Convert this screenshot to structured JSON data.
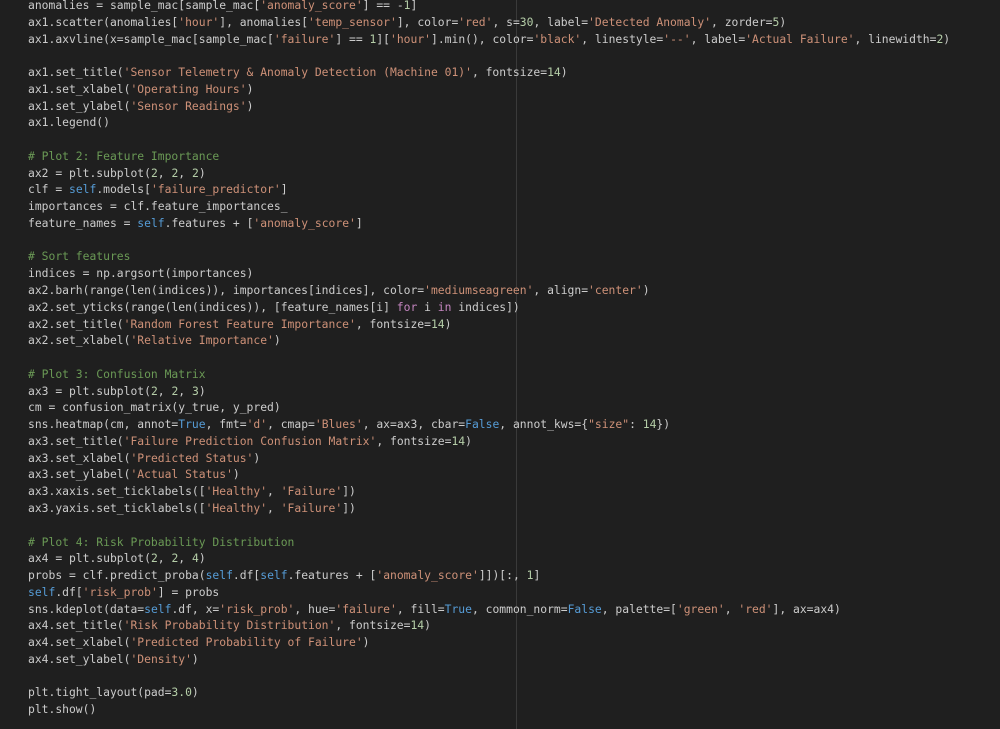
{
  "editor": {
    "colors": {
      "background": "#1f1f1f",
      "text": "#cccccc",
      "string": "#ce9178",
      "number": "#b5cea8",
      "keyword": "#569cd6",
      "control": "#c586c0",
      "comment": "#6a9955",
      "ruler": "#3a3a3a"
    },
    "lines": [
      [
        [
          "plain",
          "anomalies = sample_mac[sample_mac["
        ],
        [
          "str",
          "'anomaly_score'"
        ],
        [
          "plain",
          "] == -"
        ],
        [
          "num",
          "1"
        ],
        [
          "plain",
          "]"
        ]
      ],
      [
        [
          "plain",
          "ax1.scatter(anomalies["
        ],
        [
          "str",
          "'hour'"
        ],
        [
          "plain",
          "], anomalies["
        ],
        [
          "str",
          "'temp_sensor'"
        ],
        [
          "plain",
          "], color="
        ],
        [
          "str",
          "'red'"
        ],
        [
          "plain",
          ", s="
        ],
        [
          "num",
          "30"
        ],
        [
          "plain",
          ", label="
        ],
        [
          "str",
          "'Detected Anomaly'"
        ],
        [
          "plain",
          ", zorder="
        ],
        [
          "num",
          "5"
        ],
        [
          "plain",
          ")"
        ]
      ],
      [
        [
          "plain",
          "ax1.axvline(x=sample_mac[sample_mac["
        ],
        [
          "str",
          "'failure'"
        ],
        [
          "plain",
          "] == "
        ],
        [
          "num",
          "1"
        ],
        [
          "plain",
          "]["
        ],
        [
          "str",
          "'hour'"
        ],
        [
          "plain",
          "].min(), color="
        ],
        [
          "str",
          "'black'"
        ],
        [
          "plain",
          ", linestyle="
        ],
        [
          "str",
          "'--'"
        ],
        [
          "plain",
          ", label="
        ],
        [
          "str",
          "'Actual Failure'"
        ],
        [
          "plain",
          ", linewidth="
        ],
        [
          "num",
          "2"
        ],
        [
          "plain",
          ")"
        ]
      ],
      [],
      [
        [
          "plain",
          "ax1.set_title("
        ],
        [
          "str",
          "'Sensor Telemetry & Anomaly Detection (Machine 01)'"
        ],
        [
          "plain",
          ", fontsize="
        ],
        [
          "num",
          "14"
        ],
        [
          "plain",
          ")"
        ]
      ],
      [
        [
          "plain",
          "ax1.set_xlabel("
        ],
        [
          "str",
          "'Operating Hours'"
        ],
        [
          "plain",
          ")"
        ]
      ],
      [
        [
          "plain",
          "ax1.set_ylabel("
        ],
        [
          "str",
          "'Sensor Readings'"
        ],
        [
          "plain",
          ")"
        ]
      ],
      [
        [
          "plain",
          "ax1.legend()"
        ]
      ],
      [],
      [
        [
          "cmt",
          "# Plot 2: Feature Importance"
        ]
      ],
      [
        [
          "plain",
          "ax2 = plt.subplot("
        ],
        [
          "num",
          "2"
        ],
        [
          "plain",
          ", "
        ],
        [
          "num",
          "2"
        ],
        [
          "plain",
          ", "
        ],
        [
          "num",
          "2"
        ],
        [
          "plain",
          ")"
        ]
      ],
      [
        [
          "plain",
          "clf = "
        ],
        [
          "kw",
          "self"
        ],
        [
          "plain",
          ".models["
        ],
        [
          "str",
          "'failure_predictor'"
        ],
        [
          "plain",
          "]"
        ]
      ],
      [
        [
          "plain",
          "importances = clf.feature_importances_"
        ]
      ],
      [
        [
          "plain",
          "feature_names = "
        ],
        [
          "kw",
          "self"
        ],
        [
          "plain",
          ".features + ["
        ],
        [
          "str",
          "'anomaly_score'"
        ],
        [
          "plain",
          "]"
        ]
      ],
      [],
      [
        [
          "cmt",
          "# Sort features"
        ]
      ],
      [
        [
          "plain",
          "indices = np.argsort(importances)"
        ]
      ],
      [
        [
          "plain",
          "ax2.barh(range(len(indices)), importances[indices], color="
        ],
        [
          "str",
          "'mediumseagreen'"
        ],
        [
          "plain",
          ", align="
        ],
        [
          "str",
          "'center'"
        ],
        [
          "plain",
          ")"
        ]
      ],
      [
        [
          "plain",
          "ax2.set_yticks(range(len(indices)), [feature_names[i] "
        ],
        [
          "ctl",
          "for"
        ],
        [
          "plain",
          " i "
        ],
        [
          "ctl",
          "in"
        ],
        [
          "plain",
          " indices])"
        ]
      ],
      [
        [
          "plain",
          "ax2.set_title("
        ],
        [
          "str",
          "'Random Forest Feature Importance'"
        ],
        [
          "plain",
          ", fontsize="
        ],
        [
          "num",
          "14"
        ],
        [
          "plain",
          ")"
        ]
      ],
      [
        [
          "plain",
          "ax2.set_xlabel("
        ],
        [
          "str",
          "'Relative Importance'"
        ],
        [
          "plain",
          ")"
        ]
      ],
      [],
      [
        [
          "cmt",
          "# Plot 3: Confusion Matrix"
        ]
      ],
      [
        [
          "plain",
          "ax3 = plt.subplot("
        ],
        [
          "num",
          "2"
        ],
        [
          "plain",
          ", "
        ],
        [
          "num",
          "2"
        ],
        [
          "plain",
          ", "
        ],
        [
          "num",
          "3"
        ],
        [
          "plain",
          ")"
        ]
      ],
      [
        [
          "plain",
          "cm = confusion_matrix(y_true, y_pred)"
        ]
      ],
      [
        [
          "plain",
          "sns.heatmap(cm, annot="
        ],
        [
          "kw",
          "True"
        ],
        [
          "plain",
          ", fmt="
        ],
        [
          "str",
          "'d'"
        ],
        [
          "plain",
          ", cmap="
        ],
        [
          "str",
          "'Blues'"
        ],
        [
          "plain",
          ", ax=ax3, cbar="
        ],
        [
          "kw",
          "False"
        ],
        [
          "plain",
          ", annot_kws={"
        ],
        [
          "str",
          "\"size\""
        ],
        [
          "plain",
          ": "
        ],
        [
          "num",
          "14"
        ],
        [
          "plain",
          "})"
        ]
      ],
      [
        [
          "plain",
          "ax3.set_title("
        ],
        [
          "str",
          "'Failure Prediction Confusion Matrix'"
        ],
        [
          "plain",
          ", fontsize="
        ],
        [
          "num",
          "14"
        ],
        [
          "plain",
          ")"
        ]
      ],
      [
        [
          "plain",
          "ax3.set_xlabel("
        ],
        [
          "str",
          "'Predicted Status'"
        ],
        [
          "plain",
          ")"
        ]
      ],
      [
        [
          "plain",
          "ax3.set_ylabel("
        ],
        [
          "str",
          "'Actual Status'"
        ],
        [
          "plain",
          ")"
        ]
      ],
      [
        [
          "plain",
          "ax3.xaxis.set_ticklabels(["
        ],
        [
          "str",
          "'Healthy'"
        ],
        [
          "plain",
          ", "
        ],
        [
          "str",
          "'Failure'"
        ],
        [
          "plain",
          "])"
        ]
      ],
      [
        [
          "plain",
          "ax3.yaxis.set_ticklabels(["
        ],
        [
          "str",
          "'Healthy'"
        ],
        [
          "plain",
          ", "
        ],
        [
          "str",
          "'Failure'"
        ],
        [
          "plain",
          "])"
        ]
      ],
      [],
      [
        [
          "cmt",
          "# Plot 4: Risk Probability Distribution"
        ]
      ],
      [
        [
          "plain",
          "ax4 = plt.subplot("
        ],
        [
          "num",
          "2"
        ],
        [
          "plain",
          ", "
        ],
        [
          "num",
          "2"
        ],
        [
          "plain",
          ", "
        ],
        [
          "num",
          "4"
        ],
        [
          "plain",
          ")"
        ]
      ],
      [
        [
          "plain",
          "probs = clf.predict_proba("
        ],
        [
          "kw",
          "self"
        ],
        [
          "plain",
          ".df["
        ],
        [
          "kw",
          "self"
        ],
        [
          "plain",
          ".features + ["
        ],
        [
          "str",
          "'anomaly_score'"
        ],
        [
          "plain",
          "]])[:, "
        ],
        [
          "num",
          "1"
        ],
        [
          "plain",
          "]"
        ]
      ],
      [
        [
          "kw",
          "self"
        ],
        [
          "plain",
          ".df["
        ],
        [
          "str",
          "'risk_prob'"
        ],
        [
          "plain",
          "] = probs"
        ]
      ],
      [
        [
          "plain",
          "sns.kdeplot(data="
        ],
        [
          "kw",
          "self"
        ],
        [
          "plain",
          ".df, x="
        ],
        [
          "str",
          "'risk_prob'"
        ],
        [
          "plain",
          ", hue="
        ],
        [
          "str",
          "'failure'"
        ],
        [
          "plain",
          ", fill="
        ],
        [
          "kw",
          "True"
        ],
        [
          "plain",
          ", common_norm="
        ],
        [
          "kw",
          "False"
        ],
        [
          "plain",
          ", palette=["
        ],
        [
          "str",
          "'green'"
        ],
        [
          "plain",
          ", "
        ],
        [
          "str",
          "'red'"
        ],
        [
          "plain",
          "], ax=ax4)"
        ]
      ],
      [
        [
          "plain",
          "ax4.set_title("
        ],
        [
          "str",
          "'Risk Probability Distribution'"
        ],
        [
          "plain",
          ", fontsize="
        ],
        [
          "num",
          "14"
        ],
        [
          "plain",
          ")"
        ]
      ],
      [
        [
          "plain",
          "ax4.set_xlabel("
        ],
        [
          "str",
          "'Predicted Probability of Failure'"
        ],
        [
          "plain",
          ")"
        ]
      ],
      [
        [
          "plain",
          "ax4.set_ylabel("
        ],
        [
          "str",
          "'Density'"
        ],
        [
          "plain",
          ")"
        ]
      ],
      [],
      [
        [
          "plain",
          "plt.tight_layout(pad="
        ],
        [
          "num",
          "3.0"
        ],
        [
          "plain",
          ")"
        ]
      ],
      [
        [
          "plain",
          "plt.show()"
        ]
      ]
    ]
  }
}
